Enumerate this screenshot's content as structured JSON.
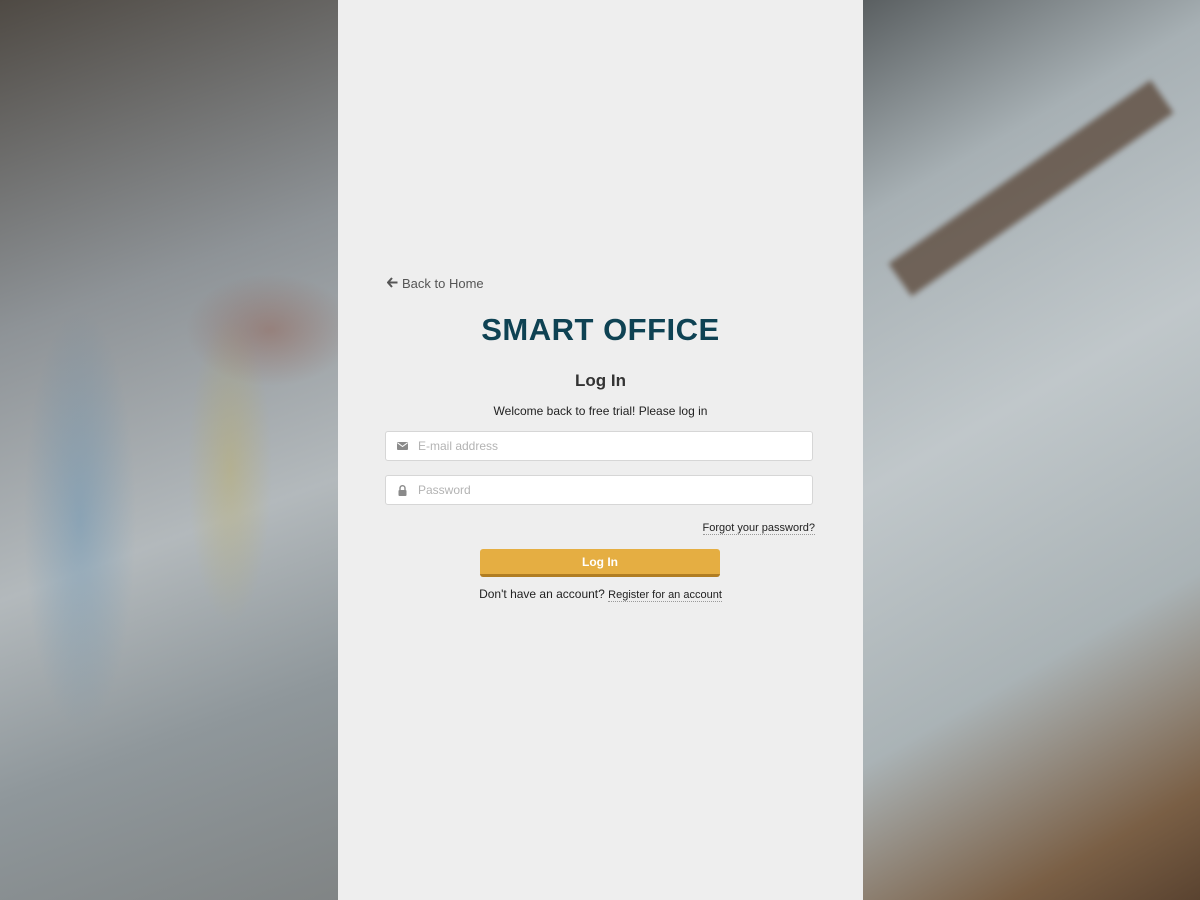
{
  "nav": {
    "back_label": "Back to Home"
  },
  "brand": {
    "logo_text": "SMART OFFICE",
    "color": "#0e4253"
  },
  "login": {
    "title": "Log In",
    "welcome": "Welcome back to free trial! Please log in",
    "email_placeholder": "E-mail address",
    "email_value": "",
    "password_placeholder": "Password",
    "password_value": "",
    "forgot_label": "Forgot your password?",
    "submit_label": "Log In",
    "submit_color": "#e5ae42",
    "no_account_text": "Don't have an account?",
    "register_label": "Register for an account"
  },
  "icons": {
    "back": "arrow-left-icon",
    "email": "envelope-icon",
    "password": "lock-icon"
  }
}
